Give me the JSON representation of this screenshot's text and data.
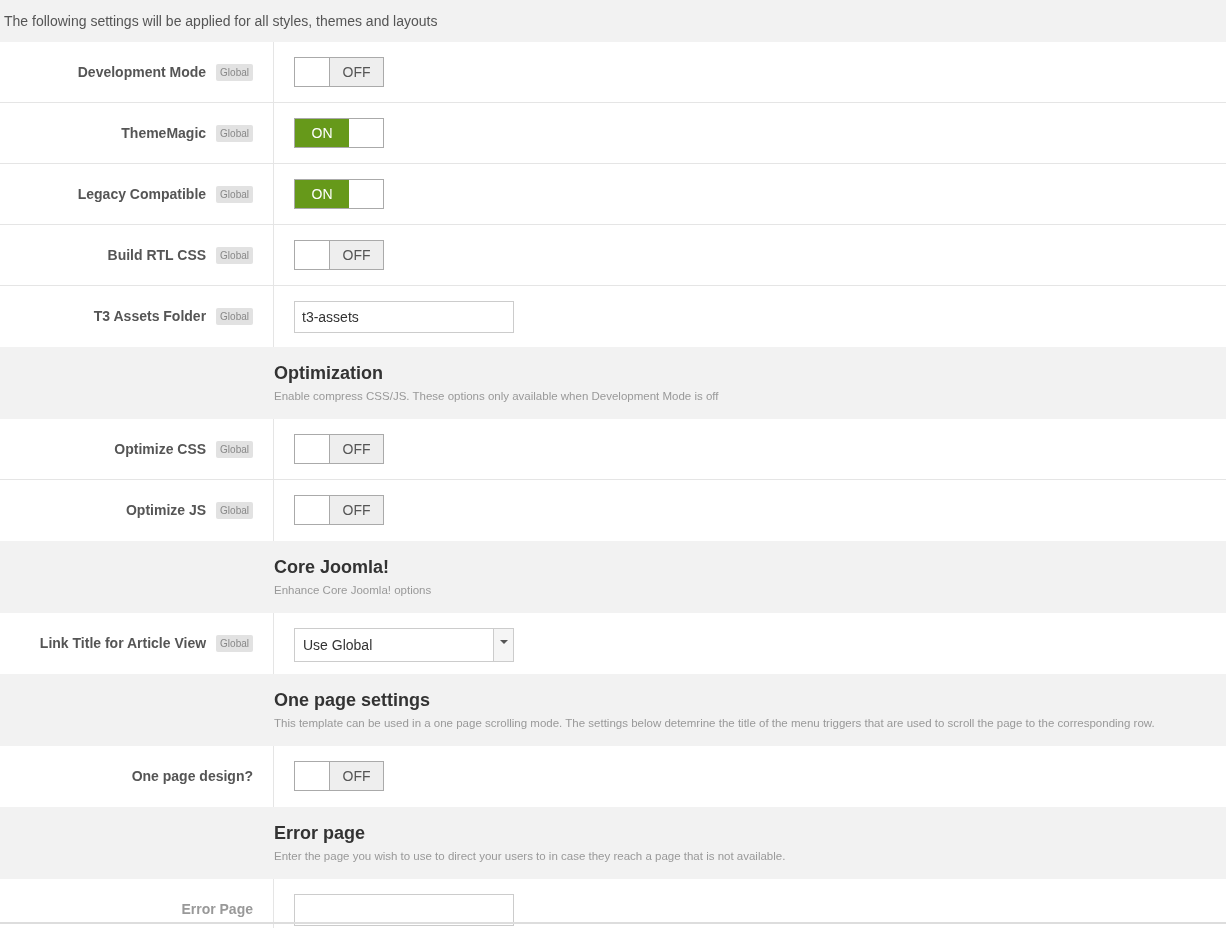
{
  "intro": "The following settings will be applied for all styles, themes and layouts",
  "groups": [
    {
      "rows": [
        {
          "kind": "toggle",
          "label": "Development Mode",
          "badge": "Global",
          "on": false,
          "disabled": false,
          "text": "OFF"
        },
        {
          "kind": "toggle",
          "label": "ThemeMagic",
          "badge": "Global",
          "on": true,
          "disabled": false,
          "text": "ON"
        },
        {
          "kind": "toggle",
          "label": "Legacy Compatible",
          "badge": "Global",
          "on": true,
          "disabled": false,
          "text": "ON"
        },
        {
          "kind": "toggle",
          "label": "Build RTL CSS",
          "badge": "Global",
          "on": false,
          "disabled": false,
          "text": "OFF"
        },
        {
          "kind": "text",
          "label": "T3 Assets Folder",
          "badge": "Global",
          "value": "t3-assets",
          "disabled": false
        }
      ]
    },
    {
      "heading": "Optimization",
      "description": "Enable compress CSS/JS. These options only available when Development Mode is off",
      "rows": [
        {
          "kind": "toggle",
          "label": "Optimize CSS",
          "badge": "Global",
          "on": false,
          "disabled": false,
          "text": "OFF"
        },
        {
          "kind": "toggle",
          "label": "Optimize JS",
          "badge": "Global",
          "on": false,
          "disabled": false,
          "text": "OFF"
        }
      ]
    },
    {
      "heading": "Core Joomla!",
      "description": "Enhance Core Joomla! options",
      "rows": [
        {
          "kind": "select",
          "label": "Link Title for Article View",
          "badge": "Global",
          "value": "Use Global",
          "disabled": false
        }
      ]
    },
    {
      "heading": "One page settings",
      "description": "This template can be used in a one page scrolling mode. The settings below detemrine the title of the menu triggers that are used to scroll the page to the corresponding row.",
      "rows": [
        {
          "kind": "toggle",
          "label": "One page design?",
          "on": false,
          "disabled": false,
          "text": "OFF"
        }
      ]
    },
    {
      "heading": "Error page",
      "description": "Enter the page you wish to use to direct your users to in case they reach a page that is not available.",
      "rows": [
        {
          "kind": "text",
          "label": "Error Page",
          "value": "",
          "disabled": true
        }
      ]
    }
  ]
}
